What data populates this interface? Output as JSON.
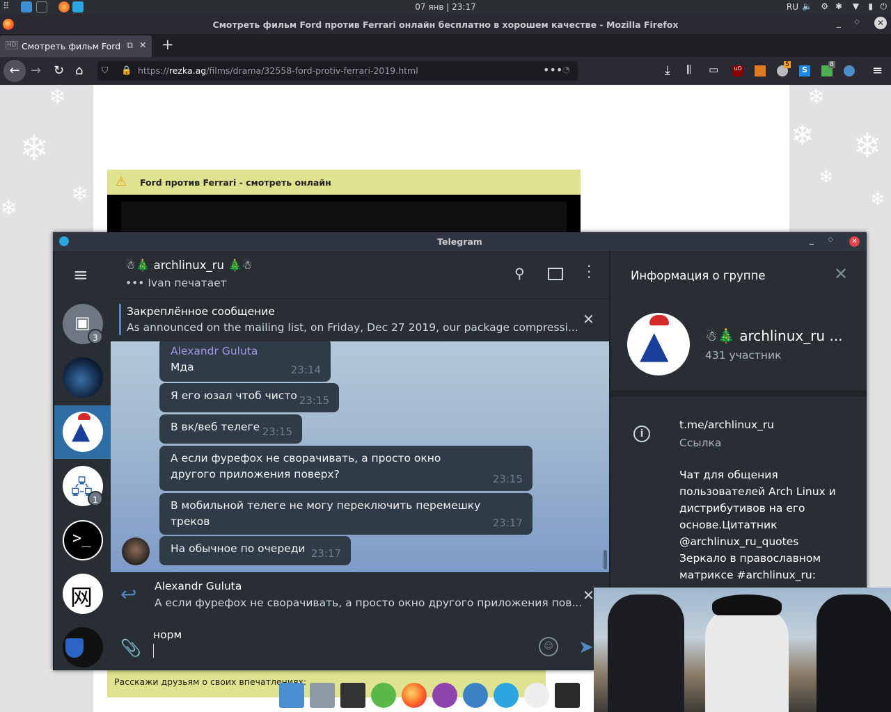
{
  "panel": {
    "clock": "07 янв  | 23:17",
    "lang": "RU"
  },
  "firefox": {
    "window_title": "Смотреть фильм Ford против Ferrari онлайн бесплатно в хорошем качестве - Mozilla Firefox",
    "tab_label": "Смотреть фильм Ford п",
    "tab_badge": "HD",
    "url_prefix": "https://",
    "url_host": "rezka.ag",
    "url_path": "/films/drama/32558-ford-protiv-ferrari-2019.html",
    "ext_badge_1": "5",
    "ext_badge_2": "8"
  },
  "page": {
    "warning_title": "Ford против Ferrari - смотреть онлайн",
    "share_text": "Расскажи друзьям о своих впечатлениях:"
  },
  "telegram": {
    "window_title": "Telegram",
    "chat_title": "☃🎄 archlinux_ru 🎄☃",
    "chat_status": "••• Ivan печатает",
    "pinned_label": "Закреплённое сообщение",
    "pinned_text": "As announced on the mailing list, on Friday, Dec 27 2019, our package compressi...",
    "badge_archive": "3",
    "badge_net": "1",
    "messages": [
      {
        "author": "Alexandr Guluta",
        "text": "Мда",
        "time": "23:14"
      },
      {
        "text": "Я его юзал чтоб чисто",
        "time": "23:15"
      },
      {
        "text": "В вк/веб телеге",
        "time": "23:15"
      },
      {
        "text": "А если фурефох не сворачивать, а просто окно другого приложения поверх?",
        "time": "23:15"
      },
      {
        "text": "В мобильной телеге не могу переключить перемешку треков",
        "time": "23:17"
      },
      {
        "text": "На обычное по очереди",
        "time": "23:17"
      }
    ],
    "reply": {
      "author": "Alexandr Guluta",
      "text": "А если фурефох не сворачивать, а просто окно другого приложения пов..."
    },
    "input_value": "норм",
    "info": {
      "panel_title": "Информация о группе",
      "group_name": "☃🎄 archlinux_ru ...",
      "members": "431 участник",
      "link": "t.me/archlinux_ru",
      "link_label": "Ссылка",
      "description": "Чат для общения пользователей Arch Linux и дистрибутивов на его основе.Цитатник @archlinux_ru_quotes Зеркало в православном матриксе #archlinux_ru:"
    }
  },
  "colors": {
    "accent": "#5288c1",
    "author": "#a695e7",
    "warn_bar": "#dfe28e"
  }
}
